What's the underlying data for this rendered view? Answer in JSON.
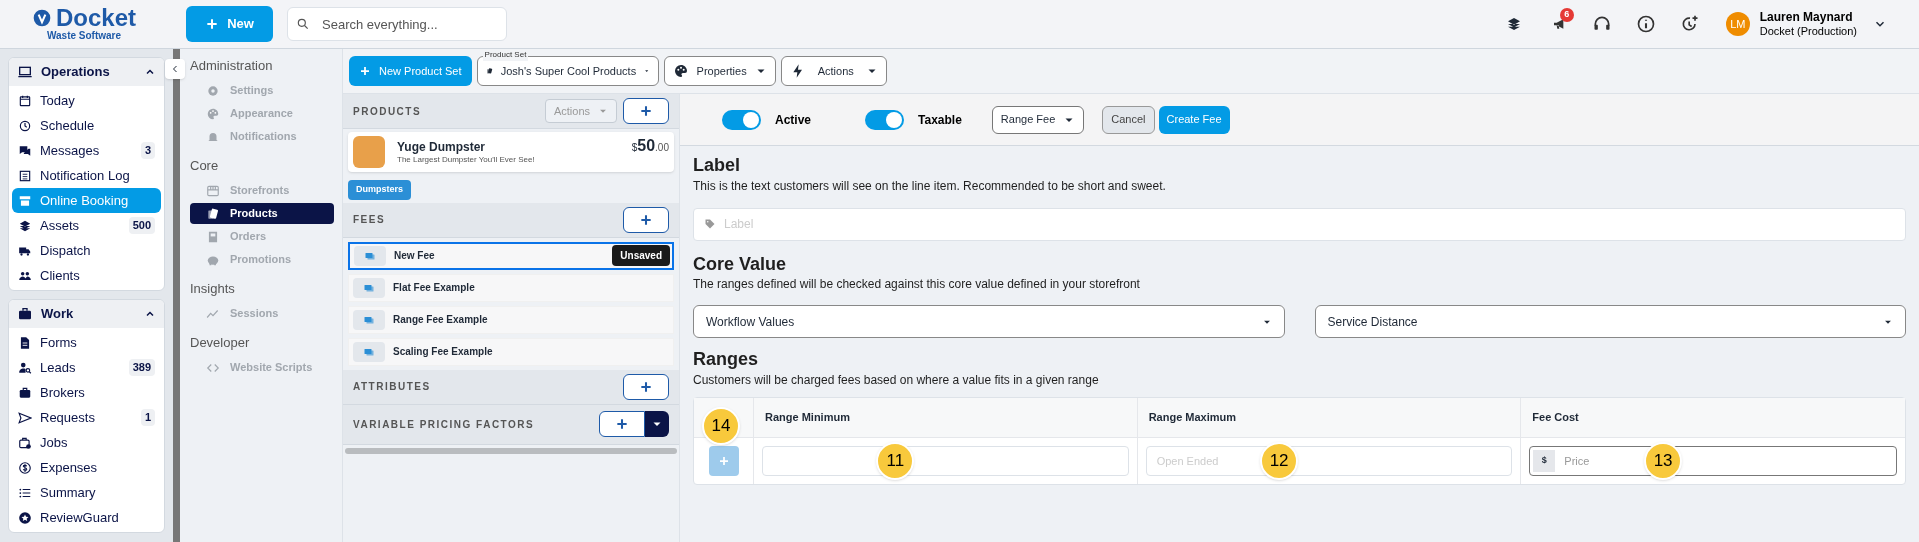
{
  "header": {
    "logo": {
      "name": "Docket",
      "subtitle": "Waste Software"
    },
    "new_button": "New",
    "search": {
      "placeholder": "Search everything..."
    },
    "notification_count": "6",
    "user": {
      "initials": "LM",
      "name": "Lauren Maynard",
      "org": "Docket (Production)"
    }
  },
  "sidebar": {
    "sections": [
      {
        "title": "Operations",
        "expanded": true,
        "items": [
          {
            "label": "Today",
            "selected": false
          },
          {
            "label": "Schedule",
            "selected": false
          },
          {
            "label": "Messages",
            "selected": false,
            "badge": "3"
          },
          {
            "label": "Notification Log",
            "selected": false
          },
          {
            "label": "Online Booking",
            "selected": true
          },
          {
            "label": "Assets",
            "selected": false,
            "badge": "500"
          },
          {
            "label": "Dispatch",
            "selected": false
          },
          {
            "label": "Clients",
            "selected": false
          }
        ]
      },
      {
        "title": "Work",
        "expanded": true,
        "items": [
          {
            "label": "Forms",
            "selected": false
          },
          {
            "label": "Leads",
            "selected": false,
            "badge": "389"
          },
          {
            "label": "Brokers",
            "selected": false
          },
          {
            "label": "Requests",
            "selected": false,
            "badge": "1"
          },
          {
            "label": "Jobs",
            "selected": false
          },
          {
            "label": "Expenses",
            "selected": false
          },
          {
            "label": "Summary",
            "selected": false
          },
          {
            "label": "ReviewGuard",
            "selected": false
          }
        ]
      }
    ]
  },
  "admin_nav": [
    {
      "title": "Administration",
      "items": [
        {
          "label": "Settings",
          "selected": false
        },
        {
          "label": "Appearance",
          "selected": false
        },
        {
          "label": "Notifications",
          "selected": false
        }
      ]
    },
    {
      "title": "Core",
      "items": [
        {
          "label": "Storefronts",
          "selected": false
        },
        {
          "label": "Products",
          "selected": true
        },
        {
          "label": "Orders",
          "selected": false
        },
        {
          "label": "Promotions",
          "selected": false
        }
      ]
    },
    {
      "title": "Insights",
      "items": [
        {
          "label": "Sessions",
          "selected": false
        }
      ]
    },
    {
      "title": "Developer",
      "items": [
        {
          "label": "Website Scripts",
          "selected": false
        }
      ]
    }
  ],
  "toolbar": {
    "new_product_set": "New Product Set",
    "product_set": {
      "legend": "Product Set",
      "value": "Josh's Super Cool Products"
    },
    "properties": "Properties",
    "actions": "Actions"
  },
  "products_panel": {
    "products": {
      "title": "PRODUCTS",
      "actions": "Actions",
      "items": [
        {
          "name": "Yuge Dumpster",
          "description": "The Largest Dumpster You'll Ever See!",
          "price_symbol": "$",
          "price_whole": "50",
          "price_cents": ".00"
        }
      ],
      "tag": "Dumpsters"
    },
    "fees": {
      "title": "FEES",
      "items": [
        {
          "label": "New Fee",
          "selected": true,
          "badge": "Unsaved"
        },
        {
          "label": "Flat Fee Example",
          "selected": false
        },
        {
          "label": "Range Fee Example",
          "selected": false
        },
        {
          "label": "Scaling Fee Example",
          "selected": false
        }
      ]
    },
    "attributes": {
      "title": "ATTRIBUTES"
    },
    "variable_pricing_factors": {
      "title": "VARIABLE PRICING FACTORS"
    }
  },
  "fee_form": {
    "toggles": [
      {
        "label": "Active",
        "on": true
      },
      {
        "label": "Taxable",
        "on": true
      }
    ],
    "fee_type": "Range Fee",
    "cancel": "Cancel",
    "create": "Create Fee",
    "label_section": {
      "title": "Label",
      "description": "This is the text customers will see on the line item. Recommended to be short and sweet.",
      "placeholder": "Label"
    },
    "core_value": {
      "title": "Core Value",
      "description": "The ranges defined will be checked against this core value defined in your storefront",
      "selects": [
        "Workflow Values",
        "Service Distance"
      ]
    },
    "ranges": {
      "title": "Ranges",
      "description": "Customers will be charged fees based on where a value fits in a given range",
      "columns": [
        "Range Minimum",
        "Range Maximum",
        "Fee Cost"
      ],
      "add_callout": "14",
      "inputs": [
        {
          "callout": "11"
        },
        {
          "placeholder": "Open Ended",
          "callout": "12"
        },
        {
          "prefix": "$",
          "placeholder": "Price",
          "callout": "13"
        }
      ]
    }
  }
}
